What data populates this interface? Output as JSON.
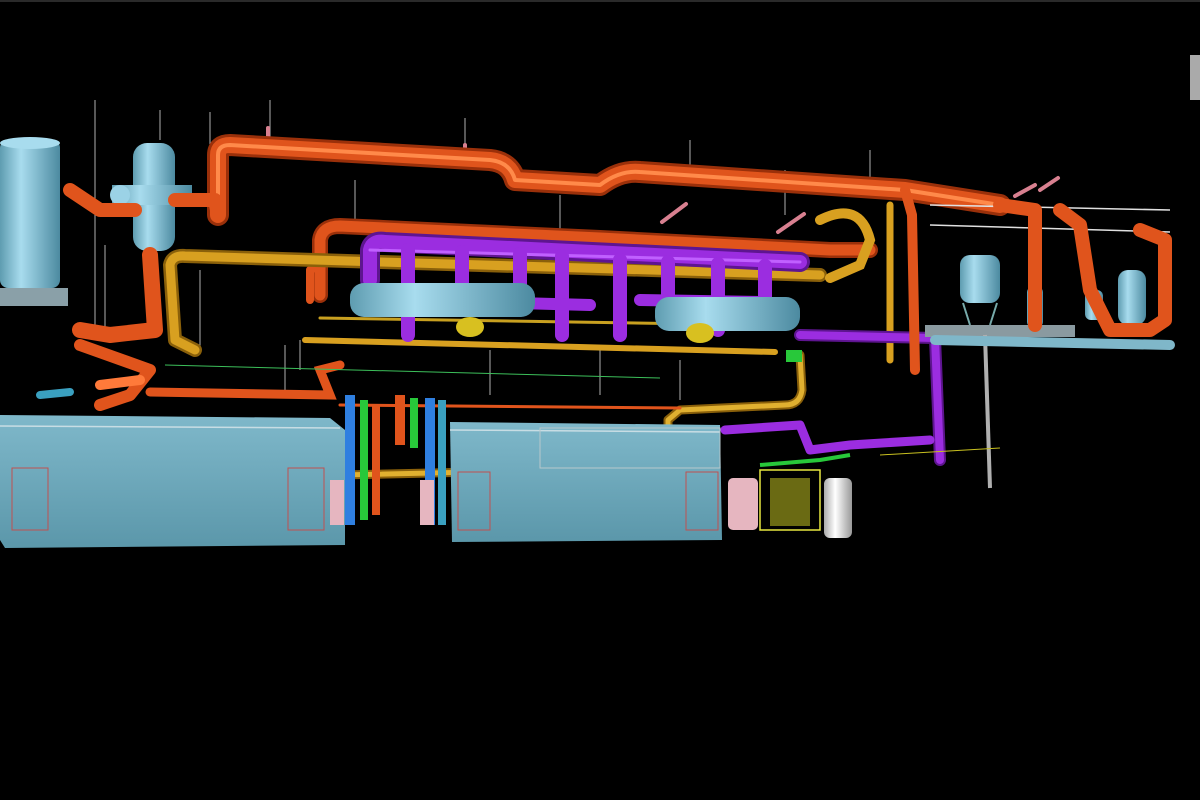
{
  "viewport": {
    "background": "#000000"
  },
  "colors": {
    "hot_water_pipe": "#e0541c",
    "hot_water_pipe_dark": "#a8360c",
    "chilled_pipe": "#9b2de0",
    "chilled_pipe_dark": "#6a1aa0",
    "gold_pipe": "#d8a020",
    "gold_pipe_dark": "#9a7010",
    "equipment": "#7fb7c9",
    "equipment_dark": "#4d8ca0",
    "tank": "#8ec6dc",
    "hanger": "#d88090",
    "hanger_line": "#c8c8c8",
    "valve_green": "#28c83a",
    "valve_blue": "#2f7fe0",
    "valve_yellow": "#e8e840",
    "white_tank": "#e8e8e8",
    "pink_tank": "#e6b6c0",
    "guide_line": "#3cbf5a",
    "outline": "#c05050"
  },
  "components": {
    "tanks": [
      "tank-left-large",
      "tank-vertical-separator",
      "tank-right-a",
      "tank-right-b",
      "tank-white"
    ],
    "pipe_systems": [
      "hot-water",
      "chilled-water",
      "condensate"
    ],
    "units": [
      "air-handler-left",
      "air-handler-right",
      "skid-right"
    ]
  }
}
